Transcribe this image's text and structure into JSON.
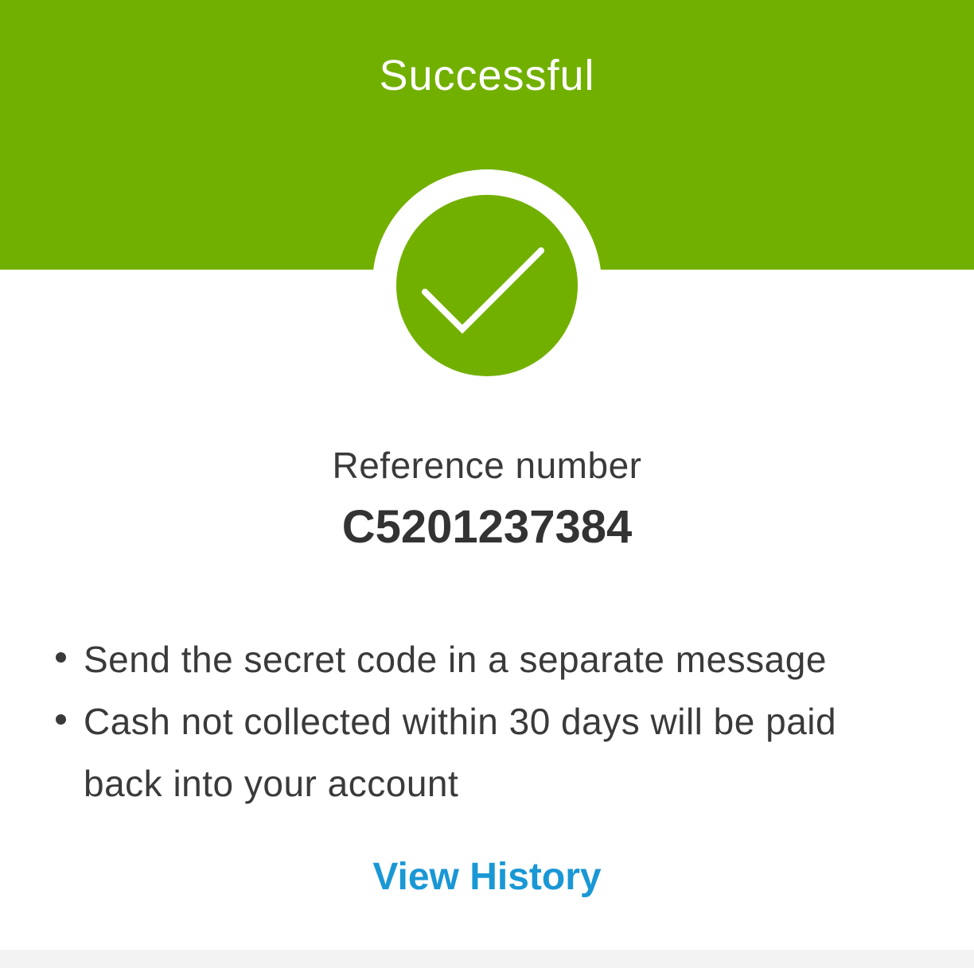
{
  "header": {
    "title": "Successful",
    "color": "#72b000"
  },
  "status_icon": "check-circle-icon",
  "reference": {
    "label": "Reference number",
    "value": "C5201237384"
  },
  "notes": [
    "Send the secret code in a separate message",
    "Cash not collected within 30 days will be paid back into your account"
  ],
  "actions": {
    "view_history_label": "View History",
    "link_color": "#1a97d5"
  }
}
